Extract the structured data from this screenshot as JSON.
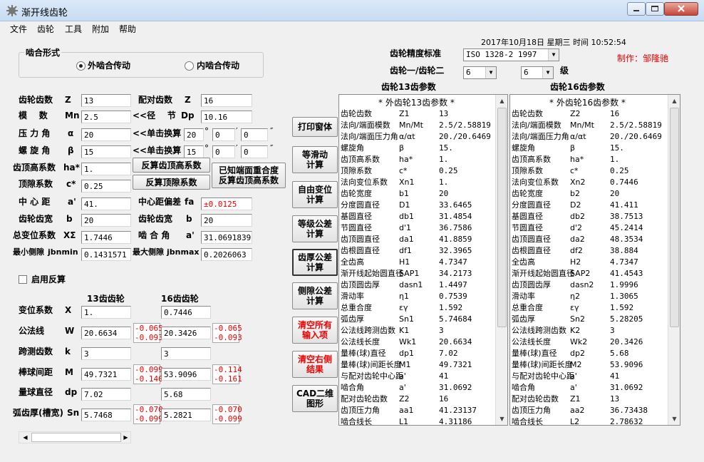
{
  "window": {
    "title": "渐开线齿轮"
  },
  "menu": [
    "文件",
    "齿轮",
    "工具",
    "附加",
    "帮助"
  ],
  "datetime": "2017年10月18日 星期三 时间 10:52:54",
  "author": "制作：邹隆驰",
  "mesh": {
    "group_label": "啮合形式",
    "external": "外啮合传动",
    "internal": "内啮合传动"
  },
  "precision": {
    "label": "齿轮精度标准",
    "value": "ISO 1328-2 1997",
    "grade_label": "齿轮一/齿轮二",
    "grade1": "6",
    "grade2": "6",
    "grade_unit": "级"
  },
  "params": {
    "teeth": {
      "label": "齿轮齿数",
      "sym": "Z",
      "value": "13"
    },
    "mate_teeth": {
      "label": "配对齿数",
      "sym": "Z",
      "value": "16"
    },
    "module": {
      "label": "模    数",
      "sym": "Mn",
      "value": "2.5"
    },
    "pitch": {
      "label": "<<径    节",
      "sym": "Dp",
      "value": "10.16"
    },
    "pressure": {
      "label": "压 力 角",
      "sym": "α",
      "value": "20"
    },
    "pressure_conv": {
      "label": "<<单击换算",
      "deg": "20",
      "min": "0",
      "sec": "0"
    },
    "helix": {
      "label": "螺 旋 角",
      "sym": "β",
      "value": "15"
    },
    "helix_conv": {
      "label": "<<单击换算",
      "deg": "15",
      "min": "0",
      "sec": "0"
    },
    "addendum": {
      "label": "齿顶高系数",
      "sym": "ha*",
      "value": "1."
    },
    "clearance": {
      "label": "顶隙系数",
      "sym": "c*",
      "value": "0.25"
    },
    "center": {
      "label": "中 心 距",
      "sym": "a'",
      "value": "41."
    },
    "center_dev": {
      "label": "中心距偏差",
      "sym": "fa",
      "value": "±0.0125"
    },
    "width1": {
      "label": "齿轮齿宽",
      "sym": "b",
      "value": "20"
    },
    "width2": {
      "label": "齿轮齿宽",
      "sym": "b",
      "value": "20"
    },
    "total_shift": {
      "label": "总变位系数",
      "sym": "XΣ",
      "value": "1.7446"
    },
    "mesh_angle": {
      "label": "啮 合 角",
      "sym": "a'",
      "value": "31.06918391"
    },
    "min_backlash": {
      "label": "最小侧隙",
      "sym": "jbnmin",
      "value": "0.1431571"
    },
    "max_backlash": {
      "label": "最大侧隙",
      "sym": "jbnmax",
      "value": "0.2026063"
    }
  },
  "buttons": {
    "reverse_addendum": "反算齿顶高系数",
    "reverse_clearance": "反算顶隙系数",
    "known_overlap": "已知端面重合度\n反算齿顶高系数",
    "print": "打印窗体",
    "equal_slide": "等滑动\n计算",
    "free_shift": "自由变位\n计算",
    "grade_tol": "等级公差\n计算",
    "thick_tol": "齿厚公差\n计算",
    "backlash_tol": "侧隙公差\n计算",
    "clear_inputs": "清空所有\n输入项",
    "clear_results": "清空右侧\n结果",
    "cad": "CAD二维\n图形"
  },
  "reverse_check": "启用反算",
  "gear_cols": {
    "g1": "13齿齿轮",
    "g2": "16齿齿轮"
  },
  "gear_rows": [
    {
      "label": "变位系数",
      "sym": "X",
      "v1": "1.",
      "v2": "0.7446"
    },
    {
      "label": "公法线",
      "sym": "W",
      "v1": "20.6634",
      "t1a": "-0.065",
      "t1b": "-0.093",
      "v2": "20.3426",
      "t2a": "-0.065",
      "t2b": "-0.093"
    },
    {
      "label": "跨测齿数",
      "sym": "k",
      "v1": "3",
      "v2": "3"
    },
    {
      "label": "棒球间距",
      "sym": "M",
      "v1": "49.7321",
      "t1a": "-0.099",
      "t1b": "-0.140",
      "v2": "53.9096",
      "t2a": "-0.114",
      "t2b": "-0.161"
    },
    {
      "label": "量球直径",
      "sym": "dp",
      "v1": "7.02",
      "v2": "5.68"
    },
    {
      "label": "弧齿厚(槽宽)",
      "sym": "Sn",
      "v1": "5.7468",
      "t1a": "-0.070",
      "t1b": "-0.099",
      "v2": "5.2821",
      "t2a": "-0.070",
      "t2b": "-0.099"
    }
  ],
  "panel1": {
    "title": "齿轮13齿参数",
    "rows": [
      [
        "",
        "* 外齿轮13齿参数 *",
        ""
      ],
      [
        "齿轮齿数",
        "Z1",
        "13"
      ],
      [
        "法向/端面模数",
        "Mn/Mt",
        "2.5/2.58819"
      ],
      [
        "法向/端面压力角",
        "α/αt",
        "20./20.6469"
      ],
      [
        "螺旋角",
        "β",
        "15."
      ],
      [
        "齿顶高系数",
        "ha*",
        "1."
      ],
      [
        "顶隙系数",
        "c*",
        "0.25"
      ],
      [
        "法向变位系数",
        "Xn1",
        "1."
      ],
      [
        "齿轮宽度",
        "b1",
        "20"
      ],
      [
        "分度圆直径",
        "D1",
        "33.6465"
      ],
      [
        "基圆直径",
        "db1",
        "31.4854"
      ],
      [
        "节圆直径",
        "d'1",
        "36.7586"
      ],
      [
        "齿顶圆直径",
        "da1",
        "41.8859"
      ],
      [
        "齿根圆直径",
        "df1",
        "32.3965"
      ],
      [
        "全齿高",
        "H1",
        "4.7347"
      ],
      [
        "渐开线起始圆直径",
        "SAP1",
        "34.2173"
      ],
      [
        "齿顶圆齿厚",
        "dasn1",
        "1.4497"
      ],
      [
        "滑动率",
        "η1",
        "0.7539"
      ],
      [
        "总重合度",
        "εγ",
        "1.592"
      ],
      [
        "弧齿厚",
        "Sn1",
        "5.74684"
      ],
      [
        "公法线跨测齿数",
        "K1",
        "3"
      ],
      [
        "公法线长度",
        "Wk1",
        "20.6634"
      ],
      [
        "量棒(球)直径",
        "dp1",
        "7.02"
      ],
      [
        "量棒(球)间距长度",
        "M1",
        "49.7321"
      ],
      [
        "与配对齿轮中心距",
        "a'",
        "41"
      ],
      [
        "啮合角",
        "a'",
        "31.0692"
      ],
      [
        "配对齿轮齿数",
        "Z2",
        "16"
      ],
      [
        "齿顶压力角",
        "aa1",
        "41.23137"
      ],
      [
        "啮合线长",
        "L1",
        "4.31186"
      ]
    ]
  },
  "panel2": {
    "title": "齿轮16齿参数",
    "rows": [
      [
        "",
        "* 外齿轮16齿参数 *",
        ""
      ],
      [
        "齿轮齿数",
        "Z2",
        "16"
      ],
      [
        "法向/端面模数",
        "Mn/Mt",
        "2.5/2.58819"
      ],
      [
        "法向/端面压力角",
        "α/αt",
        "20./20.6469"
      ],
      [
        "螺旋角",
        "β",
        "15."
      ],
      [
        "齿顶高系数",
        "ha*",
        "1."
      ],
      [
        "顶隙系数",
        "c*",
        "0.25"
      ],
      [
        "法向变位系数",
        "Xn2",
        "0.7446"
      ],
      [
        "齿轮宽度",
        "b2",
        "20"
      ],
      [
        "分度圆直径",
        "D2",
        "41.411"
      ],
      [
        "基圆直径",
        "db2",
        "38.7513"
      ],
      [
        "节圆直径",
        "d'2",
        "45.2414"
      ],
      [
        "齿顶圆直径",
        "da2",
        "48.3534"
      ],
      [
        "齿根圆直径",
        "df2",
        "38.884"
      ],
      [
        "全齿高",
        "H2",
        "4.7347"
      ],
      [
        "渐开线起始圆直径",
        "SAP2",
        "41.4543"
      ],
      [
        "齿顶圆齿厚",
        "dasn2",
        "1.9996"
      ],
      [
        "滑动率",
        "η2",
        "1.3065"
      ],
      [
        "总重合度",
        "εγ",
        "1.592"
      ],
      [
        "弧齿厚",
        "Sn2",
        "5.28205"
      ],
      [
        "公法线跨测齿数",
        "K2",
        "3"
      ],
      [
        "公法线长度",
        "Wk2",
        "20.3426"
      ],
      [
        "量棒(球)直径",
        "dp2",
        "5.68"
      ],
      [
        "量棒(球)间距长度",
        "M2",
        "53.9096"
      ],
      [
        "与配对齿轮中心距",
        "a'",
        "41"
      ],
      [
        "啮合角",
        "a'",
        "31.0692"
      ],
      [
        "配对齿轮齿数",
        "Z1",
        "13"
      ],
      [
        "齿顶压力角",
        "aa2",
        "36.73438"
      ],
      [
        "啮合线长",
        "L2",
        "2.78632"
      ]
    ]
  }
}
